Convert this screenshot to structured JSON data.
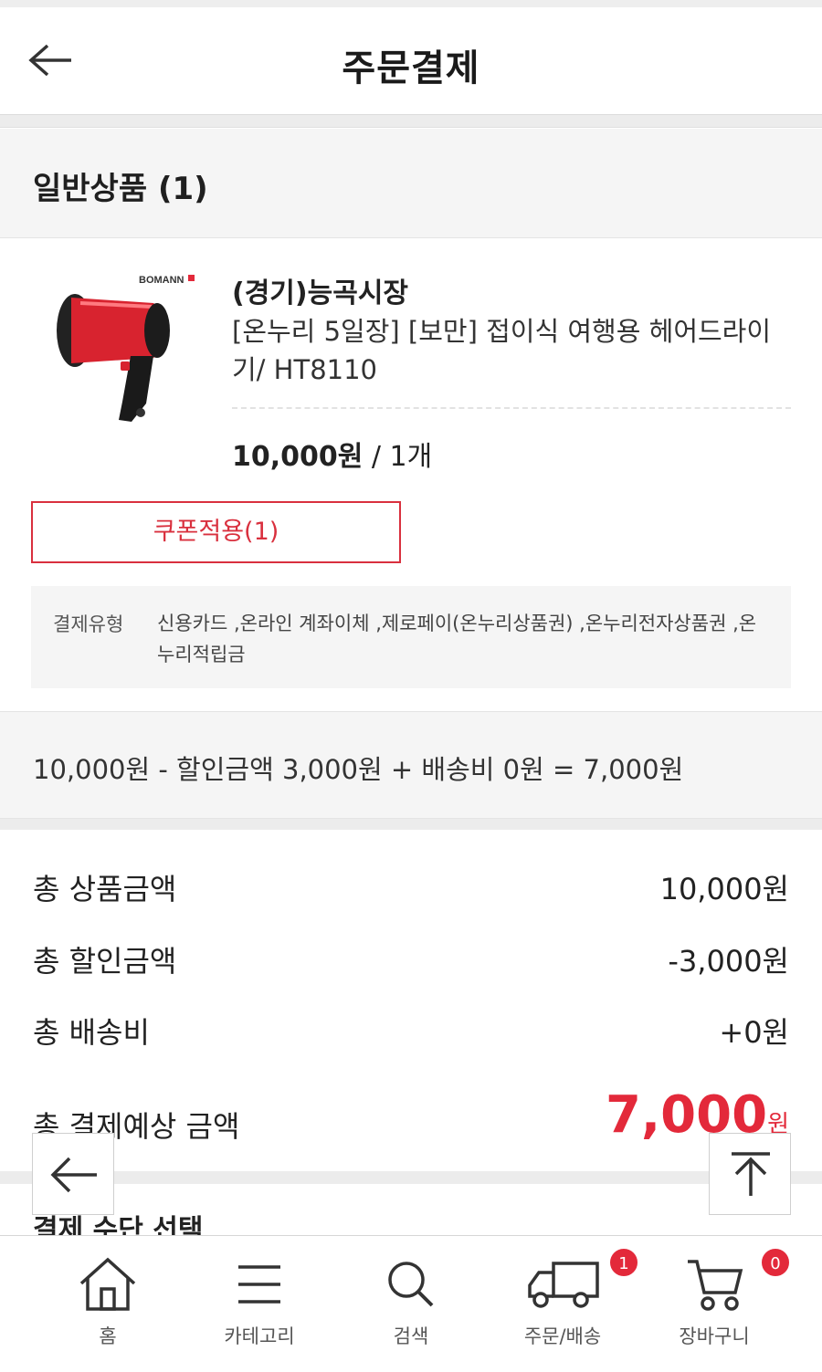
{
  "header": {
    "title": "주문결제"
  },
  "section": {
    "label": "일반상품 (1)"
  },
  "product": {
    "seller": "(경기)능곡시장",
    "name": "[온누리 5일장] [보만] 접이식 여행용 헤어드라이기/ HT8110",
    "brand_logo": "BOMANN",
    "price": "10,000원",
    "qty": " / 1개",
    "coupon_label": "쿠폰적용(1)",
    "pay_type_label": "결제유형",
    "pay_type_value": "신용카드 ,온라인 계좌이체 ,제로페이(온누리상품권) ,온누리전자상품권 ,온누리적립금"
  },
  "formula": "10,000원 - 할인금액 3,000원 + 배송비 0원 = 7,000원",
  "totals": {
    "items": [
      {
        "label": "총 상품금액",
        "value": "10,000원"
      },
      {
        "label": "총 할인금액",
        "value": "-3,000원"
      },
      {
        "label": "총 배송비",
        "value": "+0원"
      }
    ],
    "grand_label": "총 결제예상 금액",
    "grand_value": "7,000",
    "grand_unit": "원"
  },
  "pay_step": "결제 수단 선택",
  "tabbar": {
    "items": [
      {
        "label": "홈",
        "icon": "home-icon"
      },
      {
        "label": "카테고리",
        "icon": "menu-icon"
      },
      {
        "label": "검색",
        "icon": "search-icon"
      },
      {
        "label": "주문/배송",
        "icon": "truck-icon",
        "badge": "1"
      },
      {
        "label": "장바구니",
        "icon": "cart-icon",
        "badge": "0"
      }
    ]
  },
  "colors": {
    "accent": "#e3293a",
    "coupon": "#d9303e"
  }
}
